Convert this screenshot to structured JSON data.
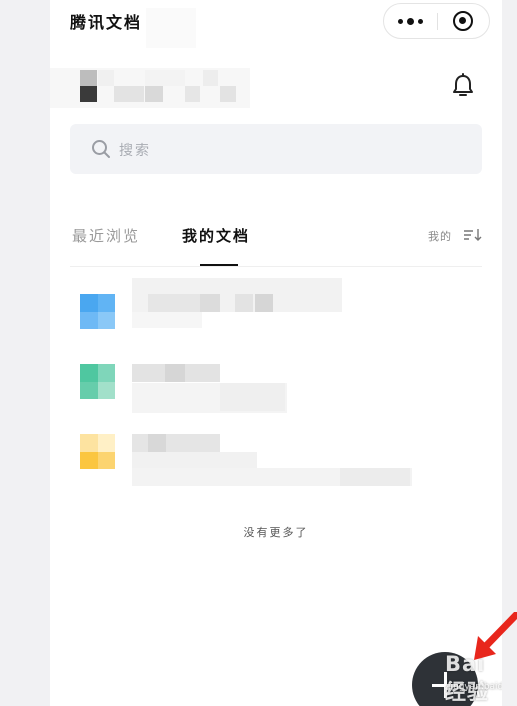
{
  "app": {
    "title": "腾讯文档"
  },
  "search": {
    "placeholder": "搜索"
  },
  "tabs": [
    {
      "label": "最近浏览",
      "active": false
    },
    {
      "label": "我的文档",
      "active": true
    }
  ],
  "sort": {
    "label": "我的"
  },
  "list": {
    "items": [
      {
        "type": "doc",
        "color": "#4aa7f0"
      },
      {
        "type": "sheet",
        "color": "#4fc7a0"
      },
      {
        "type": "slide",
        "color": "#fbc640"
      }
    ],
    "end_text": "没有更多了"
  },
  "icons": {
    "menu": "more-dots-icon",
    "close": "target-icon",
    "notification": "bell-icon",
    "search": "search-icon",
    "sort": "sort-icon",
    "add": "plus-icon"
  },
  "watermark": {
    "brand": "Bai",
    "brand_suffix": "经验",
    "url": "jingyan.baidu.com"
  },
  "colors": {
    "accent_dark": "#2e3237",
    "arrow": "#e8261c",
    "doc_blue": "#4aa7f0",
    "sheet_green": "#4fc7a0",
    "slide_yellow": "#fbc640"
  }
}
